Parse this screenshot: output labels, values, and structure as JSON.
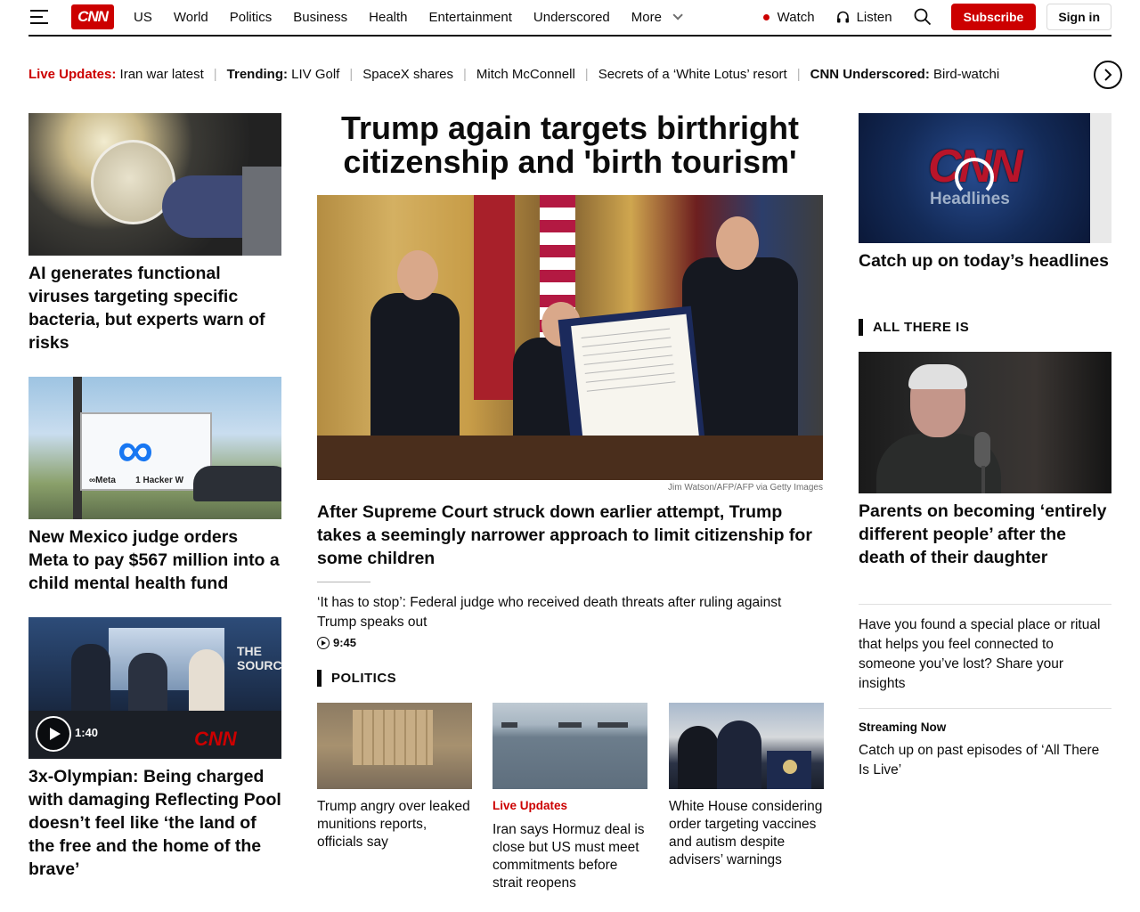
{
  "header": {
    "logo": "CNN",
    "nav": [
      "US",
      "World",
      "Politics",
      "Business",
      "Health",
      "Entertainment",
      "Underscored"
    ],
    "more_label": "More",
    "watch_label": "Watch",
    "listen_label": "Listen",
    "subscribe_label": "Subscribe",
    "signin_label": "Sign in",
    "accent_color": "#cc0000"
  },
  "ticker": {
    "live_label": "Live Updates:",
    "live_text": "Iran war latest",
    "trending_label": "Trending:",
    "trending_text": "LIV Golf",
    "items": [
      "SpaceX shares",
      "Mitch McConnell",
      "Secrets of a ‘White Lotus’ resort"
    ],
    "underscored_label": "CNN Underscored:",
    "underscored_text": "Bird-watchi"
  },
  "left": {
    "story1": "AI generates functional viruses targeting specific bacteria, but experts warn of risks",
    "story2": "New Mexico judge orders Meta to pay $567 million into a child mental health fund",
    "story2_sign": "∞Meta",
    "story2_sign_address": "1 Hacker W",
    "story3": "3x-Olympian: Being charged with damaging Reflecting Pool doesn’t feel like ‘the land of the free and the home of the brave’",
    "story3_duration": "1:40",
    "story3_show": "THE SOURCE",
    "story3_channel": "CNN"
  },
  "center": {
    "title": "Trump again targets birthright citizenship and 'birth tourism'",
    "photo_credit": "Jim Watson/AFP/AFP via Getty Images",
    "sub_headline": "After Supreme Court struck down earlier attempt, Trump takes a seemingly narrower approach to limit citizenship for some children",
    "video_headline": "‘It has to stop’: Federal judge who received death threats after ruling against Trump speaks out",
    "video_duration": "9:45",
    "section_label": "POLITICS",
    "politics": [
      {
        "tag": "",
        "headline": "Trump angry over leaked munitions reports, officials say"
      },
      {
        "tag": "Live Updates",
        "headline": "Iran says Hormuz deal is close but US must meet commitments before strait reopens"
      },
      {
        "tag": "",
        "headline": "White House considering order targeting vaccines and autism despite advisers’ warnings"
      }
    ]
  },
  "right": {
    "video_logo": "CNN",
    "video_logo_sub": "Headlines",
    "headlines_caption": "Catch up on today’s headlines",
    "section_label": "ALL THERE IS",
    "feature_headline": "Parents on becoming ‘entirely different people’ after the death of their daughter",
    "prompt_text": "Have you found a special place or ritual that helps you feel connected to someone you’ve lost? Share your insights",
    "streaming_label": "Streaming Now",
    "streaming_text": "Catch up on past episodes of ‘All There Is Live’"
  }
}
